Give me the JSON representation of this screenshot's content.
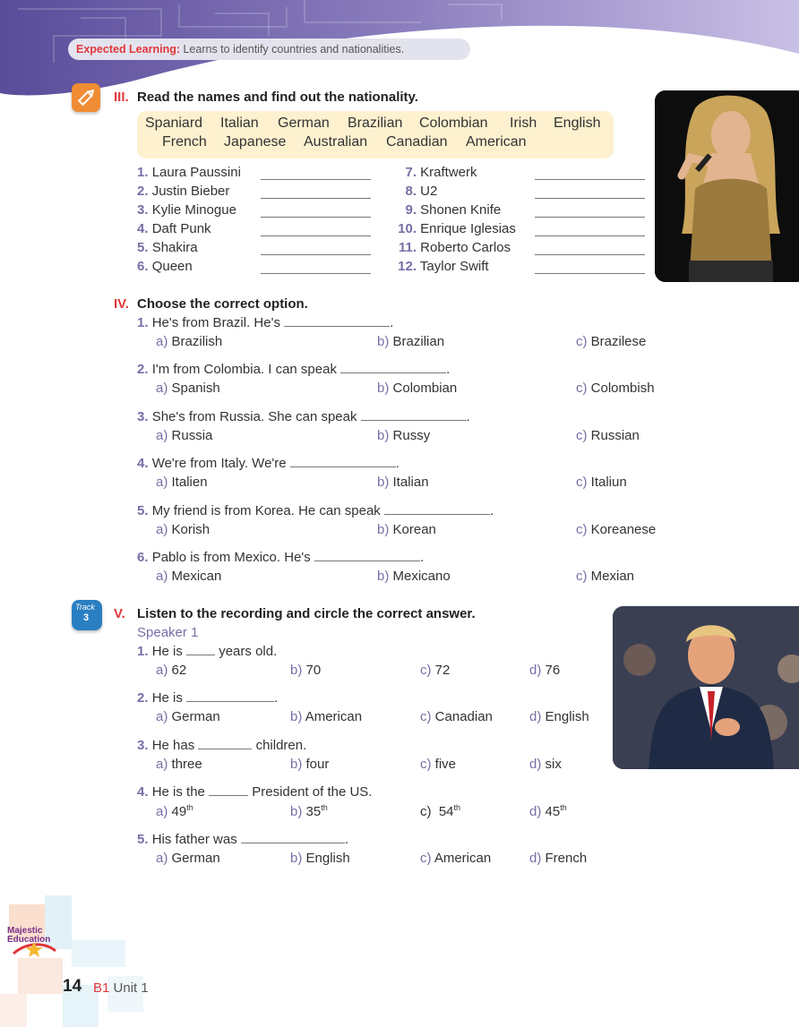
{
  "header": {
    "expected_label": "Expected Learning:",
    "expected_text": "Learns to identify countries and nationalities."
  },
  "section3": {
    "number": "III.",
    "title": "Read the names and find out the nationality.",
    "word_bank_row1": [
      "Spaniard",
      "Italian",
      "German",
      "Brazilian",
      "Colombian",
      "Irish",
      "English"
    ],
    "word_bank_row2": [
      "French",
      "Japanese",
      "Australian",
      "Canadian",
      "American"
    ],
    "items": [
      {
        "num": "1.",
        "name": "Laura Paussini"
      },
      {
        "num": "2.",
        "name": "Justin Bieber"
      },
      {
        "num": "3.",
        "name": "Kylie Minogue"
      },
      {
        "num": "4.",
        "name": "Daft Punk"
      },
      {
        "num": "5.",
        "name": "Shakira"
      },
      {
        "num": "6.",
        "name": "Queen"
      },
      {
        "num": "7.",
        "name": "Kraftwerk"
      },
      {
        "num": "8.",
        "name": "U2"
      },
      {
        "num": "9.",
        "name": "Shonen Knife"
      },
      {
        "num": "10.",
        "name": "Enrique Iglesias"
      },
      {
        "num": "11.",
        "name": "Roberto Carlos"
      },
      {
        "num": "12.",
        "name": "Taylor Swift"
      }
    ]
  },
  "section4": {
    "number": "IV.",
    "title": "Choose the correct option.",
    "questions": [
      {
        "num": "1.",
        "before": "He's from Brazil. He's",
        "after": ".",
        "a": "Brazilish",
        "b": "Brazilian",
        "c": "Brazilese"
      },
      {
        "num": "2.",
        "before": "I'm from Colombia. I can speak",
        "after": ".",
        "a": "Spanish",
        "b": "Colombian",
        "c": "Colombish"
      },
      {
        "num": "3.",
        "before": "She's from Russia. She can speak",
        "after": ".",
        "a": "Russia",
        "b": "Russy",
        "c": "Russian"
      },
      {
        "num": "4.",
        "before": "We're from Italy. We're",
        "after": ".",
        "a": "Italien",
        "b": "Italian",
        "c": "Italiun"
      },
      {
        "num": "5.",
        "before": "My friend is from Korea. He can speak",
        "after": ".",
        "a": "Korish",
        "b": "Korean",
        "c": "Koreanese"
      },
      {
        "num": "6.",
        "before": "Pablo is from Mexico. He's",
        "after": ".",
        "a": "Mexican",
        "b": "Mexicano",
        "c": "Mexian"
      }
    ],
    "opt_a": "a)",
    "opt_b": "b)",
    "opt_c": "c)"
  },
  "section5": {
    "number": "V.",
    "title": "Listen to the recording and circle the correct answer.",
    "track_label": "Track",
    "track_number": "3",
    "speaker": "Speaker 1",
    "questions": [
      {
        "num": "1.",
        "before": "He is",
        "after": "years old.",
        "a": "62",
        "b": "70",
        "c": "72",
        "d": "76"
      },
      {
        "num": "2.",
        "before": "He is",
        "after": ".",
        "a": "German",
        "b": "American",
        "c": "Canadian",
        "d": "English"
      },
      {
        "num": "3.",
        "before": "He has",
        "after": "children.",
        "a": "three",
        "b": "four",
        "c": "five",
        "d": "six"
      },
      {
        "num": "4.",
        "before": "He is the",
        "after": "President of the US.",
        "a": "49",
        "b": "35",
        "c": "54",
        "d": "45",
        "sup": "th"
      },
      {
        "num": "5.",
        "before": "His father was",
        "after": ".",
        "a": "German",
        "b": "English",
        "c": "American",
        "d": "French"
      }
    ],
    "opt_a": "a)",
    "opt_b": "b)",
    "opt_c": "c)",
    "opt_d": "d)"
  },
  "footer": {
    "page_number": "14",
    "level": "B1",
    "unit": "Unit 1",
    "brand_line1": "Majestic",
    "brand_line2": "Education"
  }
}
